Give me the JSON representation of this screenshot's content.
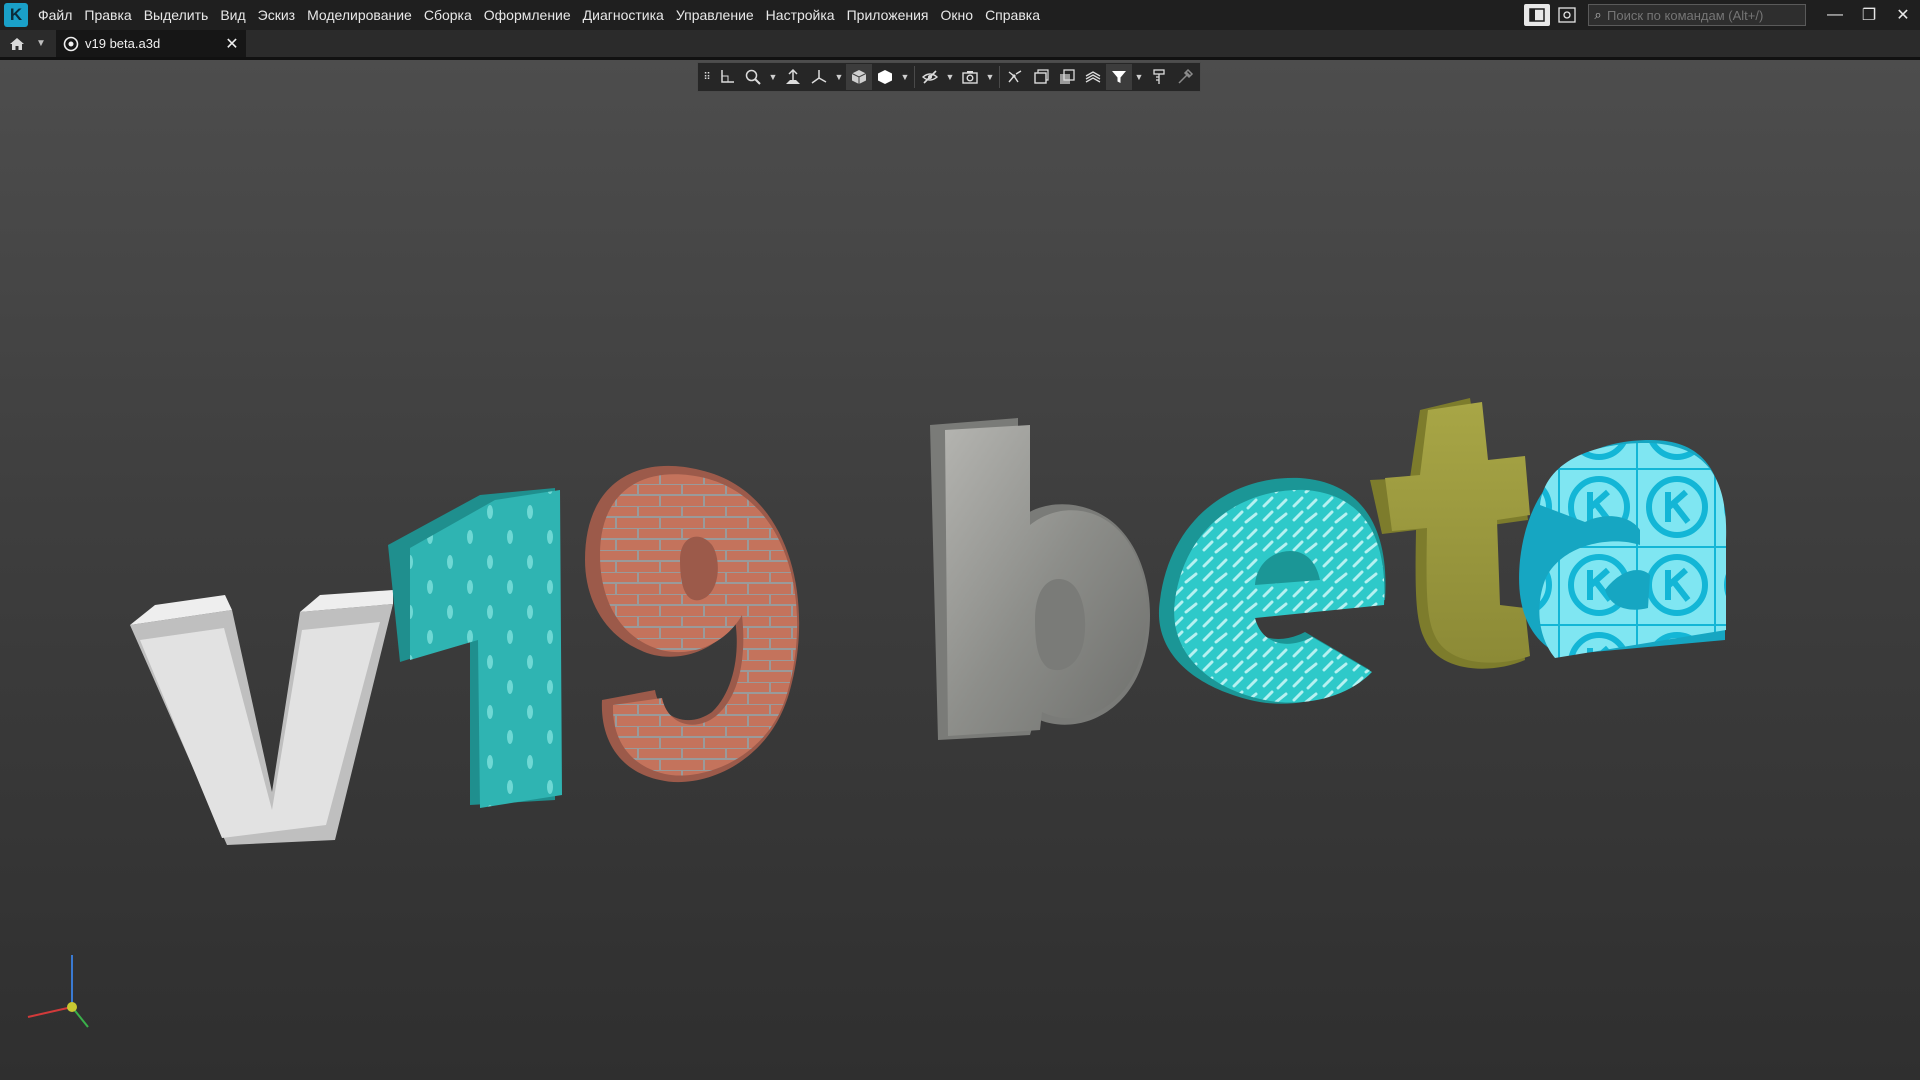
{
  "app": {
    "logo_letter": "K",
    "accent": "#1aa0c8"
  },
  "menu": {
    "items": [
      "Файл",
      "Правка",
      "Выделить",
      "Вид",
      "Эскиз",
      "Моделирование",
      "Сборка",
      "Оформление",
      "Диагностика",
      "Управление",
      "Настройка",
      "Приложения",
      "Окно",
      "Справка"
    ]
  },
  "search": {
    "placeholder": "Поиск по командам (Alt+/)"
  },
  "window_controls": {
    "minimize": "—",
    "restore": "❐",
    "close": "✕"
  },
  "tabs": [
    {
      "label": "v19 beta.a3d",
      "active": true
    }
  ],
  "toolbar": {
    "icons": [
      "grip-icon",
      "coordinate-system-icon",
      "zoom-icon",
      "orient-icon",
      "trimetric-icon",
      "shaded-cube-icon",
      "display-style-icon",
      "hide-icon",
      "camera-icon",
      "section-icon",
      "filter-icon",
      "measure-icon",
      "pipette-icon"
    ]
  },
  "scene": {
    "text": "v19 beta",
    "letters": [
      {
        "char": "v",
        "material": "white plaster",
        "color": "#d9d9d9"
      },
      {
        "char": "1",
        "material": "teal pattern",
        "color": "#2bb3b0"
      },
      {
        "char": "9",
        "material": "brick",
        "color": "#c2705a"
      },
      {
        "char": "b",
        "material": "stone",
        "color": "#9a9a9a"
      },
      {
        "char": "e",
        "material": "teal tread plate",
        "color": "#2cc6c6"
      },
      {
        "char": "t",
        "material": "olive rough",
        "color": "#9b9a3e"
      },
      {
        "char": "a",
        "material": "cyan K logo",
        "color": "#38d4ea"
      }
    ]
  },
  "triad": {
    "axes": [
      "x",
      "y",
      "z"
    ],
    "colors": {
      "x": "#d23a3a",
      "y": "#3ab04a",
      "z": "#3a7ad2"
    }
  }
}
